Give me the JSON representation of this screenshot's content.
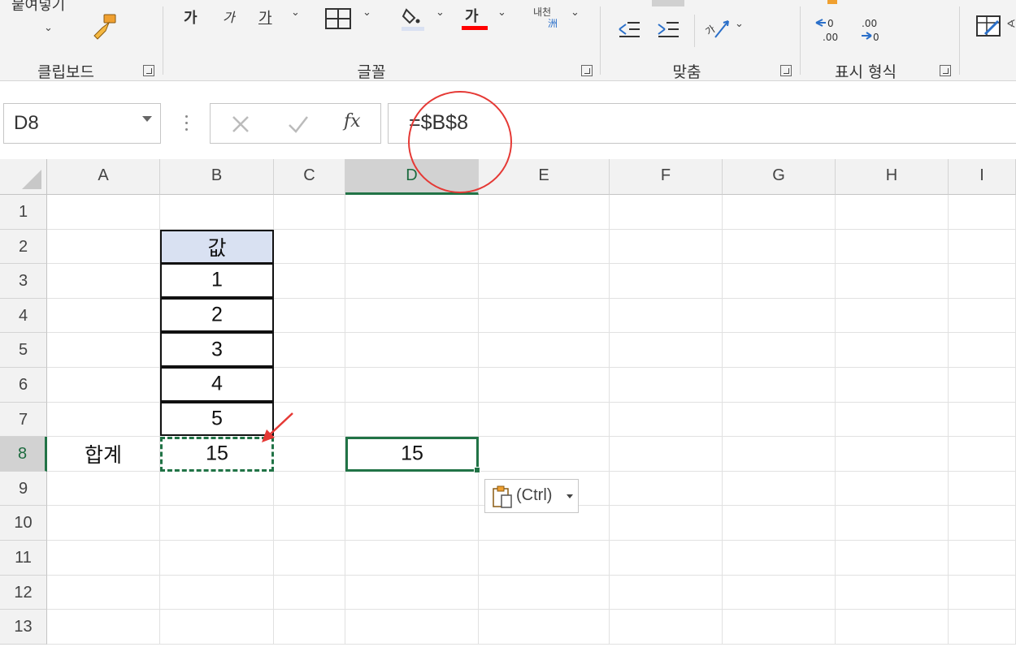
{
  "ribbon": {
    "clipboard": {
      "paste_label": "붙여넣기",
      "group_label": "클립보드"
    },
    "font": {
      "group_label": "글꼴",
      "font_bigger": "가",
      "font_smaller": "가",
      "underline": "가",
      "font_color_glyph": "가",
      "phonetic_top": "내천",
      "phonetic_bottom": "洲"
    },
    "alignment": {
      "group_label": "맞춤"
    },
    "number": {
      "group_label": "표시 형식",
      "increase_decimal": "←0 .00",
      "decrease_decimal": ".00 →0"
    }
  },
  "formula_bar": {
    "name_box": "D8",
    "formula": "=$B$8",
    "fx_label": "fx"
  },
  "columns": [
    "A",
    "B",
    "C",
    "D",
    "E",
    "F",
    "G",
    "H",
    "I"
  ],
  "rows": [
    "1",
    "2",
    "3",
    "4",
    "5",
    "6",
    "7",
    "8",
    "9",
    "10",
    "11",
    "12",
    "13"
  ],
  "cells": {
    "B2": "값",
    "B3": "1",
    "B4": "2",
    "B5": "3",
    "B6": "4",
    "B7": "5",
    "A8": "합계",
    "B8": "15",
    "D8": "15"
  },
  "paste_options": {
    "label": "(Ctrl)"
  },
  "colors": {
    "accent_green": "#217346",
    "header_fill": "#d9e1f2",
    "annotation_red": "#e53935"
  }
}
